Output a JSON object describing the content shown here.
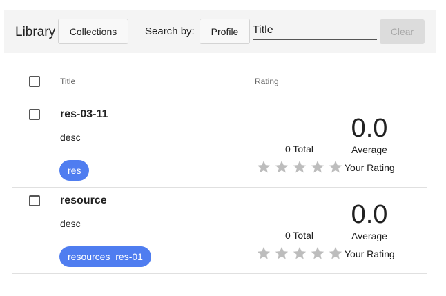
{
  "toolbar": {
    "library_label": "Library",
    "collections_label": "Collections",
    "search_by_label": "Search by:",
    "profile_label": "Profile",
    "search_value": "Title",
    "clear_label": "Clear"
  },
  "table": {
    "headers": {
      "title": "Title",
      "rating": "Rating"
    },
    "rows": [
      {
        "title": "res-03-11",
        "description": "desc",
        "tag": "res",
        "total": "0 Total",
        "average": "0.0",
        "average_label": "Average",
        "your_rating_label": "Your Rating",
        "stars_filled": 0,
        "stars_max": 5
      },
      {
        "title": "resource",
        "description": "desc",
        "tag": "resources_res-01",
        "total": "0 Total",
        "average": "0.0",
        "average_label": "Average",
        "your_rating_label": "Your Rating",
        "stars_filled": 0,
        "stars_max": 5
      }
    ]
  },
  "colors": {
    "chip": "#4f7df0",
    "star_empty": "#bdbdbd",
    "toolbar_bg": "#f4f4f4"
  }
}
